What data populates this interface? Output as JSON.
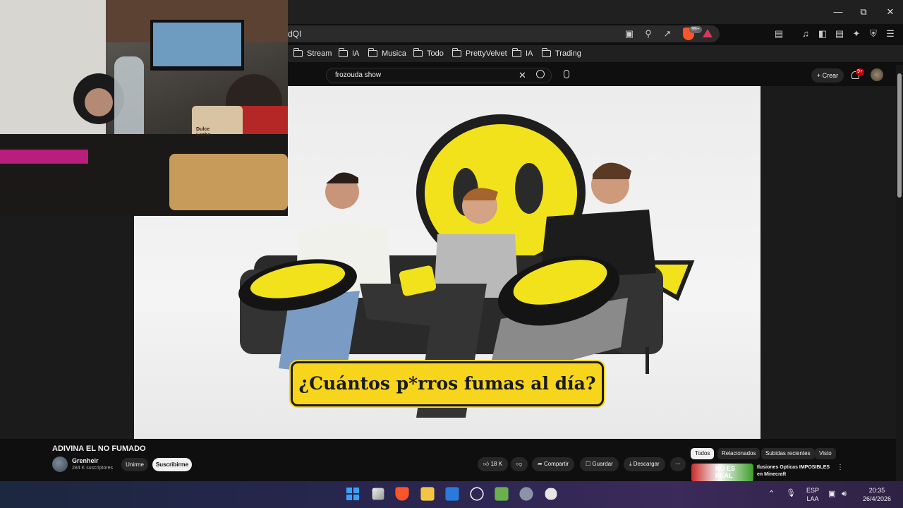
{
  "browser": {
    "address_fragment": "dQI",
    "bookmarks": [
      "Stream",
      "IA",
      "Musica",
      "Todo",
      "PrettyVelvet",
      "IA",
      "Trading"
    ],
    "extension_badge": "99+"
  },
  "youtube": {
    "search_value": "frozouda show",
    "create_label": "Crear",
    "notification_count": "9+"
  },
  "video": {
    "caption": "¿Cuántos p*rros fumas al día?",
    "title": "ADIVINA EL NO FUMADO",
    "channel_name": "Grenheir",
    "channel_subs": "284 K suscriptores",
    "join_label": "Unirme",
    "subscribe_label": "Suscribirme",
    "likes": "18 K",
    "share_label": "Compartir",
    "save_label": "Guardar",
    "download_label": "Descargar"
  },
  "webcam": {
    "bottle_label": "Dulce Leche"
  },
  "suggestions": {
    "chips": [
      "Todos",
      "Relacionados",
      "Subidas recientes",
      "Visto"
    ],
    "first_title": "Ilusiones Opticas IMPOSIBLES en Minecraft",
    "first_thumb_text": "NO ES REAL"
  },
  "taskbar": {
    "lang_top": "ESP",
    "lang_bottom": "LAA",
    "time": "20:35",
    "date": "26/4/2026"
  },
  "colors": {
    "caption_yellow": "#f7d51d",
    "youtube_bg": "#0f0f0f",
    "notification_red": "#cc0000"
  }
}
